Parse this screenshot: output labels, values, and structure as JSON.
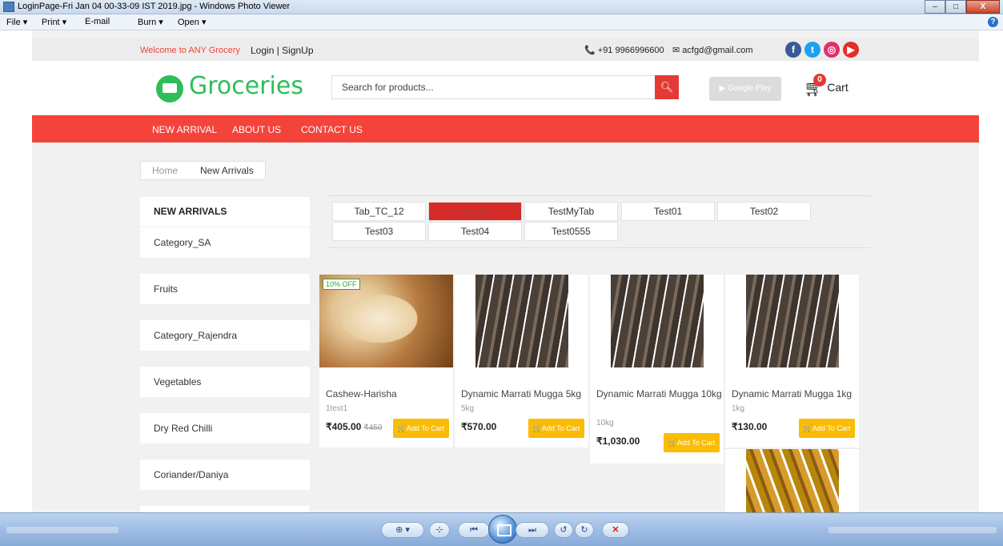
{
  "window": {
    "title": "LoginPage-Fri Jan 04 00-33-09 IST 2019.jpg - Windows Photo Viewer",
    "minimize": "–",
    "maximize": "□",
    "close": "X"
  },
  "menubar": {
    "file": "File ▾",
    "print": "Print ▾",
    "email": "E-mail",
    "burn": "Burn ▾",
    "open": "Open ▾",
    "help": "?"
  },
  "topbar": {
    "welcome": "Welcome to ANY Grocery",
    "login": "Login | SignUp",
    "phone": "+91 9966996600",
    "email": "acfgd@gmail.com",
    "social_icons": [
      "facebook-icon",
      "twitter-icon",
      "instagram-icon",
      "youtube-icon"
    ]
  },
  "header": {
    "logo_text": "Groceries",
    "search_placeholder": "Search for products...",
    "google_play": "▶ Google Play",
    "cart_label": "Cart",
    "cart_count": "0"
  },
  "nav": {
    "items": [
      "NEW ARRIVAL",
      "ABOUT US",
      "CONTACT US"
    ]
  },
  "breadcrumb": {
    "items": [
      "Home",
      "New Arrivals"
    ]
  },
  "sidebar": {
    "heading": "NEW ARRIVALS",
    "items": [
      "Category_SA",
      "Fruits",
      "Category_Rajendra",
      "Vegetables",
      "Dry Red Chilli",
      "Coriander/Daniya"
    ]
  },
  "tabs": {
    "items": [
      "Tab_TC_12",
      "Tab_SA",
      "TestMyTab",
      "Test01",
      "Test02",
      "Test03",
      "Test04",
      "Test0555"
    ],
    "active": "Tab_SA"
  },
  "products": [
    {
      "name": "Cashew-Harisha",
      "weight": "1test1",
      "price": "₹405.00",
      "old_price": "₹450",
      "badge": "10% OFF",
      "button": "🛒Add To Cart"
    },
    {
      "name": "Dynamic Marrati Mugga 5kg",
      "weight": "5kg",
      "price": "₹570.00",
      "button": "🛒Add To Cart"
    },
    {
      "name": "Dynamic Marrati Mugga 10kg",
      "weight": "10kg",
      "price": "₹1,030.00",
      "button": "🛒Add To Cart"
    },
    {
      "name": "Dynamic Marrati Mugga 1kg",
      "weight": "1kg",
      "price": "₹130.00",
      "button": "🛒Add To Cart"
    }
  ],
  "colors": {
    "brand_red": "#f4433a",
    "brand_green": "#2ebd59",
    "add_button": "#fbbc05"
  },
  "viewer_controls": {
    "zoom": "⊕ ▾",
    "fit": "⊹",
    "prev": "⏮",
    "next": "⏭",
    "rotate_ccw": "↺",
    "rotate_cw": "↻",
    "delete": "✕"
  }
}
